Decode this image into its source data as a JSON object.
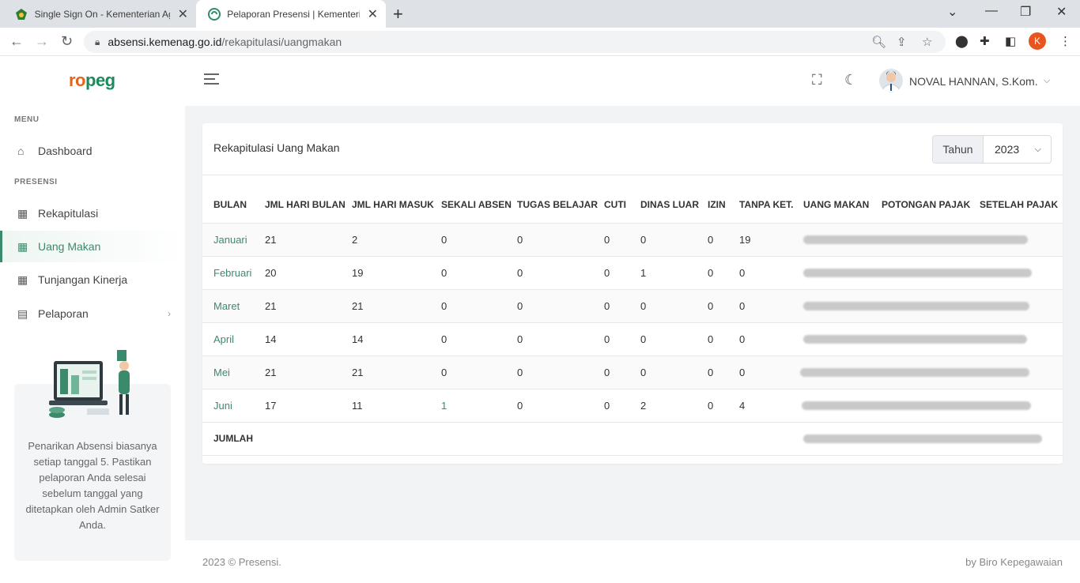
{
  "browser": {
    "tabs": [
      {
        "title": "Single Sign On - Kementerian Ag"
      },
      {
        "title": "Pelaporan Presensi | Kementerian"
      }
    ],
    "url_domain": "absensi.kemenag.go.id",
    "url_path": "/rekapitulasi/uangmakan",
    "profile_initial": "K"
  },
  "sidebar": {
    "logo_r": "ro",
    "logo_g": "peg",
    "menu_heading": "MENU",
    "presensi_heading": "PRESENSI",
    "items": [
      {
        "label": "Dashboard",
        "icon": "home-icon"
      },
      {
        "label": "Rekapitulasi",
        "icon": "calendar-icon"
      },
      {
        "label": "Uang Makan",
        "icon": "calendar-icon"
      },
      {
        "label": "Tunjangan Kinerja",
        "icon": "calendar-icon"
      },
      {
        "label": "Pelaporan",
        "icon": "document-icon"
      }
    ],
    "promo_text": "Penarikan Absensi biasanya setiap tanggal 5. Pastikan pelaporan Anda selesai sebelum tanggal yang ditetapkan oleh Admin Satker Anda."
  },
  "header": {
    "user_name": "NOVAL HANNAN, S.Kom."
  },
  "card": {
    "title": "Rekapitulasi Uang Makan",
    "year_label": "Tahun",
    "year_value": "2023"
  },
  "table": {
    "headers": [
      "BULAN",
      "JML HARI BULAN",
      "JML HARI MASUK",
      "SEKALI ABSEN",
      "TUGAS BELAJAR",
      "CUTI",
      "DINAS LUAR",
      "IZIN",
      "TANPA KET.",
      "UANG MAKAN",
      "POTONGAN PAJAK",
      "SETELAH PAJAK"
    ],
    "rows": [
      {
        "bulan": "Januari",
        "jml_hari_bulan": "21",
        "jml_hari_masuk": "2",
        "sekali_absen": "0",
        "tugas_belajar": "0",
        "cuti": "0",
        "dinas_luar": "0",
        "izin": "0",
        "tanpa_ket": "19"
      },
      {
        "bulan": "Februari",
        "jml_hari_bulan": "20",
        "jml_hari_masuk": "19",
        "sekali_absen": "0",
        "tugas_belajar": "0",
        "cuti": "0",
        "dinas_luar": "1",
        "izin": "0",
        "tanpa_ket": "0"
      },
      {
        "bulan": "Maret",
        "jml_hari_bulan": "21",
        "jml_hari_masuk": "21",
        "sekali_absen": "0",
        "tugas_belajar": "0",
        "cuti": "0",
        "dinas_luar": "0",
        "izin": "0",
        "tanpa_ket": "0"
      },
      {
        "bulan": "April",
        "jml_hari_bulan": "14",
        "jml_hari_masuk": "14",
        "sekali_absen": "0",
        "tugas_belajar": "0",
        "cuti": "0",
        "dinas_luar": "0",
        "izin": "0",
        "tanpa_ket": "0"
      },
      {
        "bulan": "Mei",
        "jml_hari_bulan": "21",
        "jml_hari_masuk": "21",
        "sekali_absen": "0",
        "tugas_belajar": "0",
        "cuti": "0",
        "dinas_luar": "0",
        "izin": "0",
        "tanpa_ket": "0"
      },
      {
        "bulan": "Juni",
        "jml_hari_bulan": "17",
        "jml_hari_masuk": "11",
        "sekali_absen": "1",
        "tugas_belajar": "0",
        "cuti": "0",
        "dinas_luar": "2",
        "izin": "0",
        "tanpa_ket": "4"
      }
    ],
    "total_label": "JUMLAH"
  },
  "footer": {
    "left": "2023 © Presensi.",
    "right": "by Biro Kepegawaian"
  },
  "colors": {
    "accent": "#3b8a6b",
    "logo_orange": "#e3651d"
  }
}
